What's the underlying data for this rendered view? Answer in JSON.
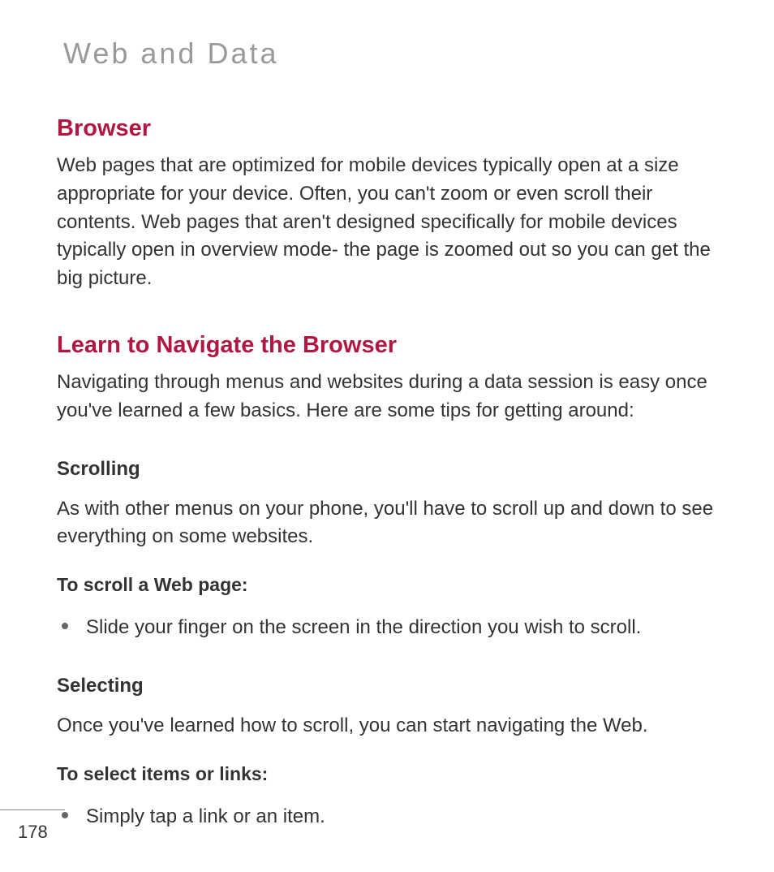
{
  "page": {
    "title": "Web and Data",
    "number": "178"
  },
  "sections": {
    "browser": {
      "heading": "Browser",
      "body": "Web pages that are optimized for mobile devices typically open at a size appropriate for your device. Often, you can't zoom or even scroll their contents. Web pages that aren't designed specifically for mobile devices typically open in overview mode- the page is zoomed out so you can get the big picture."
    },
    "navigate": {
      "heading": "Learn to Navigate the Browser",
      "body": "Navigating through menus and websites during a data session is easy once you've learned a few basics. Here are some tips for getting around:"
    },
    "scrolling": {
      "subhead": "Scrolling",
      "body": "As with other menus on your phone, you'll have to scroll up and down to see everything on some websites.",
      "howto_label": "To scroll a Web page:",
      "bullet": "Slide your finger on the screen in the direction you wish to scroll."
    },
    "selecting": {
      "subhead": "Selecting",
      "body": "Once you've learned how to scroll, you can start navigating the Web.",
      "howto_label": "To select items or links:",
      "bullet": "Simply tap a link or an item."
    }
  }
}
